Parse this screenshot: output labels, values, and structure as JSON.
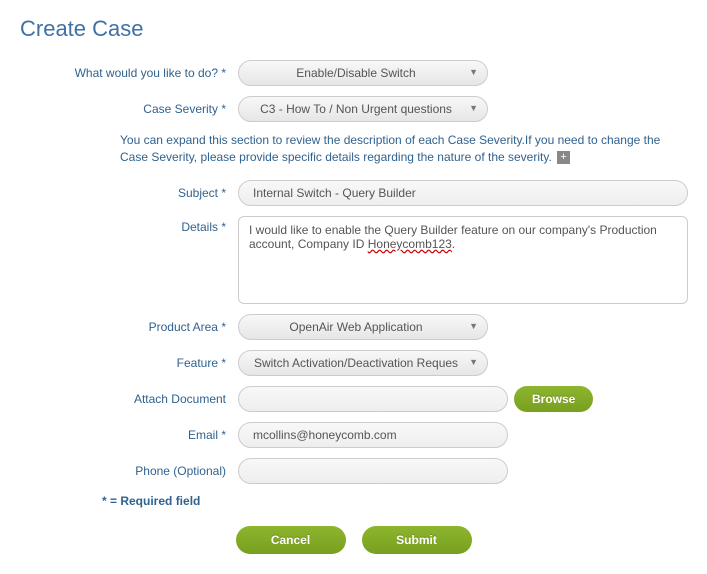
{
  "title": "Create Case",
  "labels": {
    "what_do": "What would you like to do? *",
    "severity": "Case Severity *",
    "subject": "Subject *",
    "details": "Details *",
    "product_area": "Product Area *",
    "feature": "Feature *",
    "attach": "Attach Document",
    "email": "Email *",
    "phone": "Phone (Optional)"
  },
  "fields": {
    "what_do": "Enable/Disable Switch",
    "severity": "C3 - How To / Non Urgent questions",
    "subject": "Internal Switch - Query Builder",
    "details_pre": "I would like to enable the Query Builder feature on our company's Production account, Company ID ",
    "details_mis": "Honeycomb123",
    "details_post": ".",
    "product_area": "OpenAir Web Application",
    "feature": "Switch Activation/Deactivation Reques",
    "attach": "",
    "email": "mcollins@honeycomb.com",
    "phone": ""
  },
  "info_text": "You can expand this section to review the description of each Case Severity.If you need to change the Case Severity, please provide specific details regarding the nature of the severity.",
  "expand_glyph": "+",
  "browse_label": "Browse",
  "required_note": "* = Required field",
  "buttons": {
    "cancel": "Cancel",
    "submit": "Submit"
  }
}
